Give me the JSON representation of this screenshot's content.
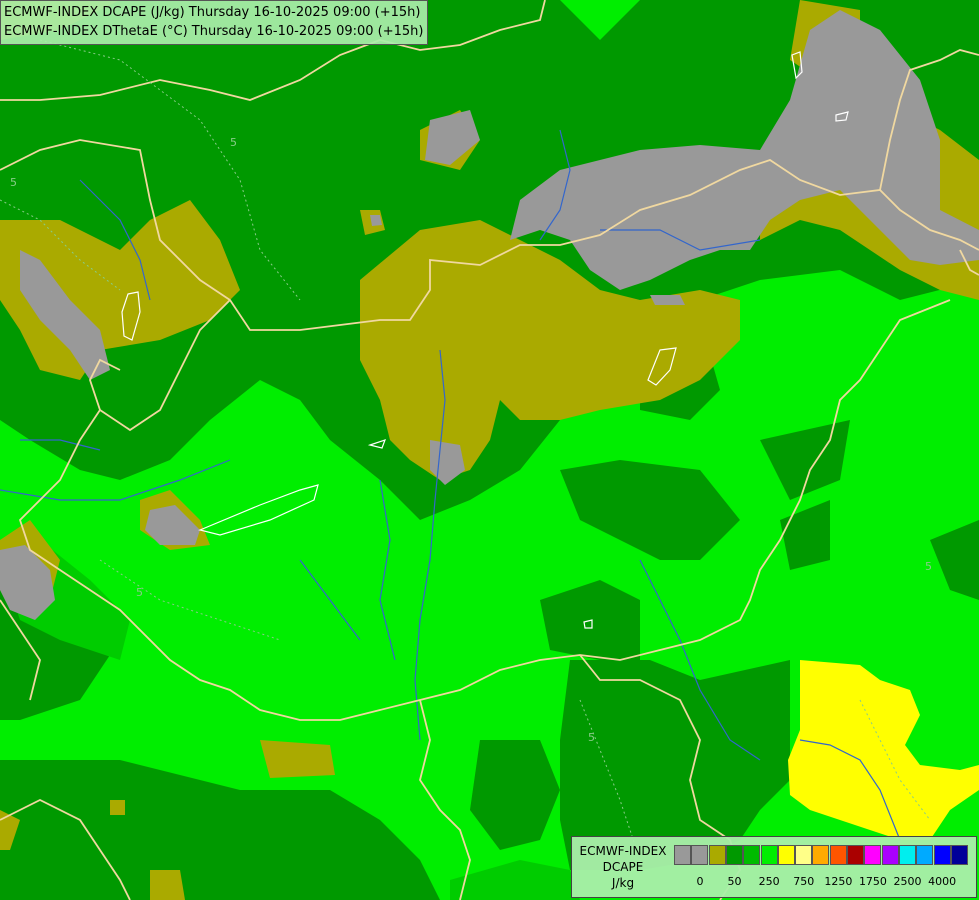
{
  "titles": {
    "line1": "ECMWF-INDEX DCAPE (J/kg) Thursday 16-10-2025 09:00 (+15h)",
    "line2": "ECMWF-INDEX DThetaE (°C) Thursday 16-10-2025 09:00 (+15h)"
  },
  "legend": {
    "model": "ECMWF-INDEX",
    "param": "DCAPE",
    "unit": "J/kg",
    "colors": [
      "#999999",
      "#999999",
      "#aaaa00",
      "#009900",
      "#00bb00",
      "#00ee00",
      "#ffff00",
      "#ffff88",
      "#ffaa00",
      "#ff5500",
      "#aa0000",
      "#ff00ff",
      "#aa00ff",
      "#00eeee",
      "#00aaff",
      "#0000ff",
      "#000099"
    ],
    "tick_labels": [
      "0",
      "50",
      "250",
      "750",
      "1250",
      "1750",
      "2500",
      "4000"
    ]
  },
  "contour_labels": [
    "5",
    "5",
    "5",
    "5",
    "5"
  ],
  "colors": {
    "grey": "#999999",
    "olive": "#aaaa00",
    "dark_green": "#009900",
    "mid_green": "#00cc00",
    "bright_green": "#00ee00",
    "yellow": "#ffff00",
    "border": "#f0d8a0",
    "river": "#3366cc",
    "lake": "#ffffff"
  }
}
